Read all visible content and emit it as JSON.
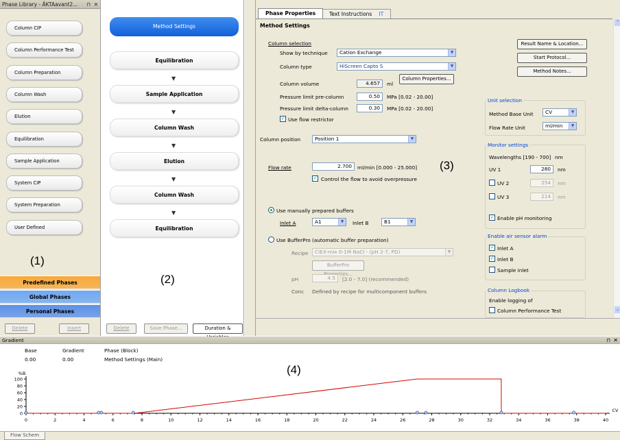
{
  "library": {
    "title": "Phase Library - ÄKTAavant2...",
    "phases": [
      "Column CIP",
      "Column Performance Test",
      "Column Preparation",
      "Column Wash",
      "Elution",
      "Equilibration",
      "Sample Application",
      "System CIP",
      "System Preparation",
      "User Defined"
    ],
    "annotation": "(1)",
    "categories": [
      {
        "label": "Predefined Phases",
        "color": "#f7a93a"
      },
      {
        "label": "Global Phases",
        "color": "#6fa8f4"
      },
      {
        "label": "Personal Phases",
        "color": "#5c91e8"
      }
    ],
    "delete_label": "Delete",
    "insert_label": "Insert"
  },
  "method": {
    "header": "Method Settings",
    "steps": [
      "Equilibration",
      "Sample Application",
      "Column Wash",
      "Elution",
      "Column Wash",
      "Equilibration"
    ],
    "annotation": "(2)",
    "delete_label": "Delete",
    "save_label": "Save Phase...",
    "duration_label": "Duration & Variables"
  },
  "props": {
    "tabs": [
      "Phase Properties",
      "Text Instructions"
    ],
    "section_title": "Method Settings",
    "column_selection": "Column selection",
    "show_by_label": "Show by technique",
    "show_by_value": "Cation Exchange",
    "column_type_label": "Column type",
    "column_type_value": "HiScreen Capto S",
    "column_volume_label": "Column volume",
    "column_volume_value": "4.657",
    "column_volume_unit": "ml",
    "column_props_label": "Column Properties...",
    "pre_label": "Pressure limit pre-column",
    "pre_value": "0.50",
    "pre_range": "MPa [0.02 - 20.00]",
    "delta_label": "Pressure limit delta-column",
    "delta_value": "0.30",
    "delta_range": "MPa [0.02 - 20.00]",
    "flow_restrictor": "Use flow restrictor",
    "column_position_label": "Column position",
    "column_position_value": "Position 1",
    "flow_rate_label": "Flow rate",
    "flow_rate_value": "2.700",
    "flow_rate_range": "ml/min  [0.000 - 25.000]",
    "control_flow": "Control the flow to avoid overpressure",
    "annotation": "(3)",
    "manual_buffers": "Use manually prepared buffers",
    "inlet_a_label": "Inlet A",
    "inlet_a_value": "A1",
    "inlet_b_label": "Inlet B",
    "inlet_b_value": "B1",
    "bufferpro": "Use BufferPro (automatic buffer preparation)",
    "recipe_label": "Recipe",
    "recipe_value": "CIEX-mix 0-1M NaCl - (pH 2-7, PD)",
    "bufferpro_props": "BufferPro Properties...",
    "ph_label": "pH",
    "ph_value": "4.5",
    "ph_range": "[2.0 - 7.0]  (recommended)",
    "conc_label": "Conc",
    "conc_text": "Defined by recipe for multicomponent buffers",
    "result_name": "Result Name & Location...",
    "start_protocol": "Start Protocol...",
    "method_notes": "Method Notes...",
    "unit_selection": "Unit selection",
    "base_unit_label": "Method Base Unit",
    "base_unit_value": "CV",
    "flow_unit_label": "Flow Rate Unit",
    "flow_unit_value": "ml/min",
    "monitor_settings": "Monitor settings",
    "wavelengths_label": "Wavelengths  [190 - 700]",
    "wavelengths_unit": "nm",
    "uv": [
      {
        "label": "UV 1",
        "value": "280",
        "checked": true
      },
      {
        "label": "UV 2",
        "value": "254",
        "checked": false
      },
      {
        "label": "UV 3",
        "value": "214",
        "checked": false
      }
    ],
    "nm": "nm",
    "enable_ph": "Enable pH monitoring",
    "air_alarm": "Enable air sensor alarm",
    "air": [
      {
        "label": "Inlet A",
        "checked": true
      },
      {
        "label": "Inlet B",
        "checked": true
      },
      {
        "label": "Sample inlet",
        "checked": false
      }
    ],
    "logbook": "Column Logbook",
    "enable_logging": "Enable logging of",
    "log_perf": "Column Performance Test"
  },
  "gradient": {
    "title": "Gradient",
    "col_base": "Base",
    "col_gradient": "Gradient",
    "col_phase": "Phase (Block)",
    "base_value": "0.00",
    "gradient_value": "0.00",
    "phase_value": "Method Settings (Main)",
    "annotation": "(4)",
    "y_unit": "%B",
    "x_unit": "CV"
  },
  "bottom_tab": "Flow Schem",
  "chart_data": {
    "type": "line",
    "xlabel": "CV",
    "ylabel": "%B",
    "xlim": [
      0,
      40
    ],
    "ylim": [
      0,
      100
    ],
    "x_ticks": [
      0,
      2,
      4,
      6,
      8,
      10,
      12,
      14,
      16,
      18,
      20,
      22,
      24,
      26,
      28,
      30,
      32,
      34,
      36,
      38,
      40
    ],
    "y_ticks": [
      0,
      20,
      40,
      60,
      80,
      100
    ],
    "series": [
      {
        "x": [
          0,
          7.5,
          27,
          32.8,
          32.8,
          40
        ],
        "y": [
          0,
          0,
          100,
          100,
          0,
          0
        ],
        "color": "#d40000"
      }
    ],
    "markers": [
      0,
      5,
      5.2,
      7.4,
      27,
      27.6,
      32.8,
      37.8
    ]
  }
}
